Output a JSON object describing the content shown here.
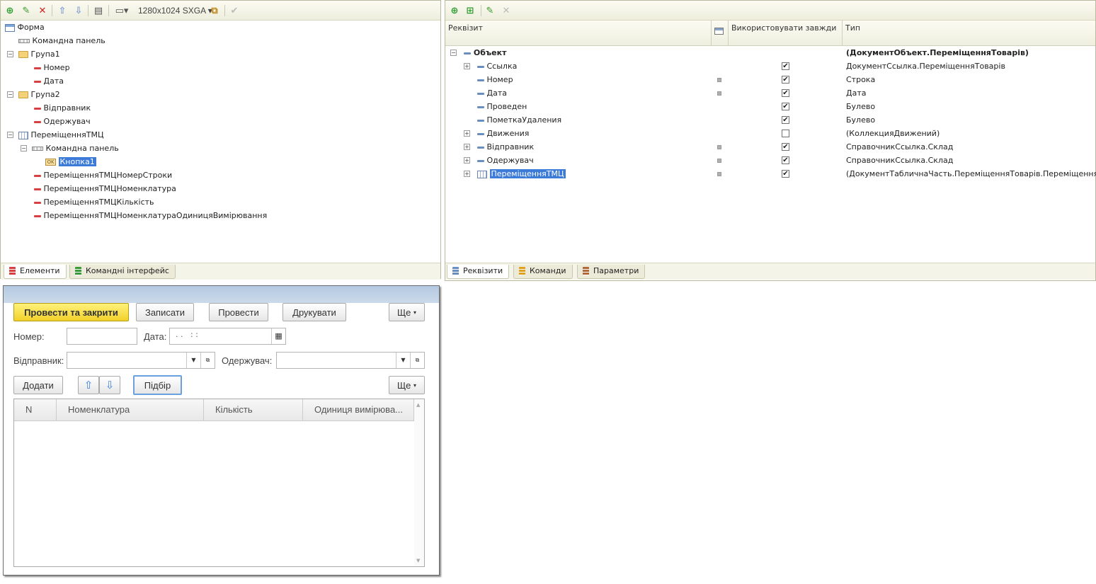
{
  "left_pane": {
    "toolbar": {
      "resolution": "1280x1024 SXGA"
    },
    "tree": [
      {
        "label": "Форма"
      },
      {
        "label": "Командна панель"
      },
      {
        "label": "Група1"
      },
      {
        "label": "Номер"
      },
      {
        "label": "Дата"
      },
      {
        "label": "Група2"
      },
      {
        "label": "Відправник"
      },
      {
        "label": "Одержувач"
      },
      {
        "label": "ПереміщенняТМЦ"
      },
      {
        "label": "Командна панель"
      },
      {
        "label": "Кнопка1"
      },
      {
        "label": "ПереміщенняТМЦНомерСтроки"
      },
      {
        "label": "ПереміщенняТМЦНоменклатура"
      },
      {
        "label": "ПереміщенняТМЦКількість"
      },
      {
        "label": "ПереміщенняТМЦНоменклатураОдиницяВимірювання"
      }
    ],
    "tabs": [
      "Елементи",
      "Командні інтерфейс"
    ]
  },
  "right_pane": {
    "headers": {
      "col1": "Реквізит",
      "col3": "Використовувати завжди",
      "col4": "Тип"
    },
    "rows": [
      {
        "name": "Объект",
        "type": "(ДокументОбъект.ПереміщенняТоварів)"
      },
      {
        "name": "Ссылка",
        "type": "ДокументСсылка.ПереміщенняТоварів"
      },
      {
        "name": "Номер",
        "type": "Строка"
      },
      {
        "name": "Дата",
        "type": "Дата"
      },
      {
        "name": "Проведен",
        "type": "Булево"
      },
      {
        "name": "ПометкаУдаления",
        "type": "Булево"
      },
      {
        "name": "Движения",
        "type": "(КоллекцияДвижений)"
      },
      {
        "name": "Відправник",
        "type": "СправочникСсылка.Склад"
      },
      {
        "name": "Одержувач",
        "type": "СправочникСсылка.Склад"
      },
      {
        "name": "ПереміщенняТМЦ",
        "type": "(ДокументТабличнаЧасть.ПереміщенняТоварів.ПереміщенняТМЦ)"
      }
    ],
    "tabs": [
      "Реквізити",
      "Команди",
      "Параметри"
    ]
  },
  "form_preview": {
    "buttons": {
      "post_close": "Провести та закрити",
      "save": "Записати",
      "post": "Провести",
      "print": "Друкувати",
      "more": "Ще",
      "add": "Додати",
      "pick": "Підбір",
      "more2": "Ще"
    },
    "labels": {
      "number": "Номер:",
      "date": "Дата:",
      "sender": "Відправник:",
      "receiver": "Одержувач:"
    },
    "date_mask": ". .   : :",
    "table_headers": [
      "N",
      "Номенклатура",
      "Кількість",
      "Одиниця вимірюва..."
    ]
  }
}
